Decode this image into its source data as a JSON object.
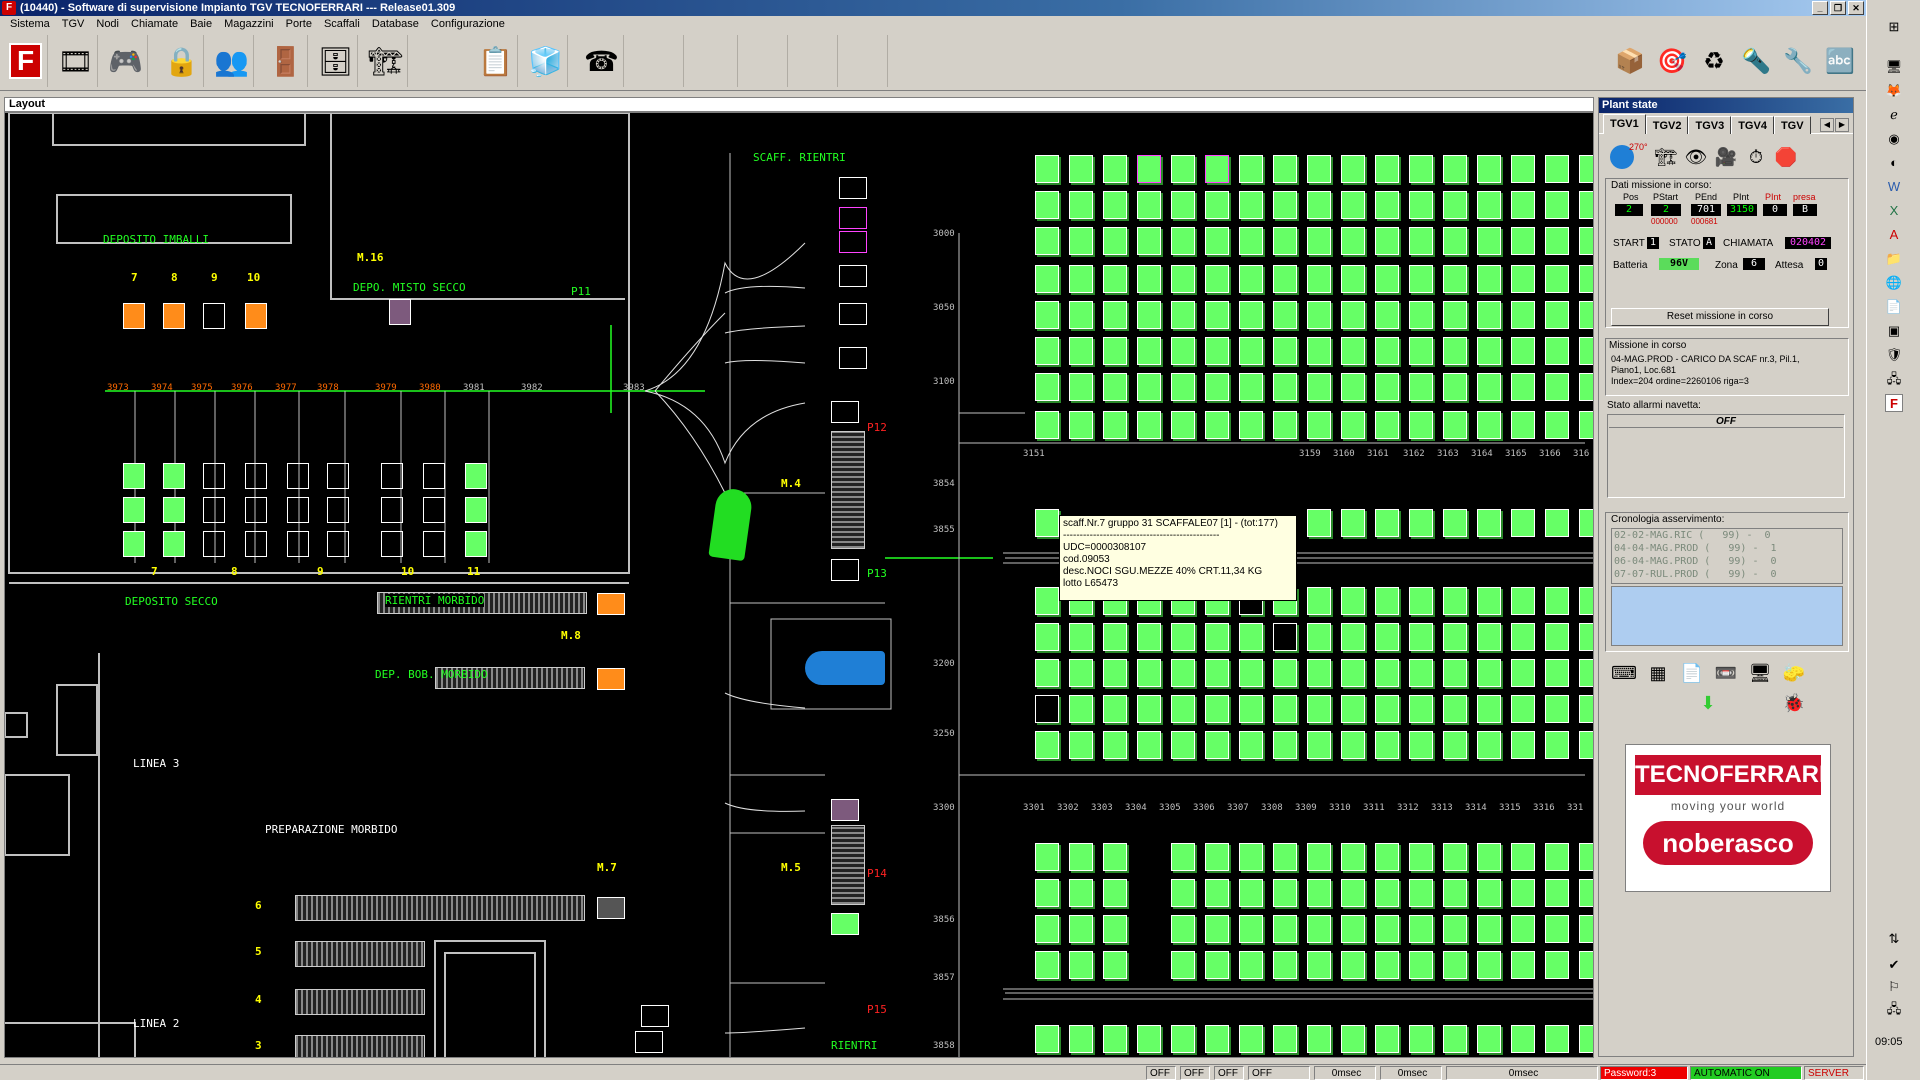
{
  "window": {
    "title": "(10440) - Software di supervisione Impianto TGV TECNOFERRARI --- Release01.309",
    "app_icon": "F"
  },
  "menu": [
    "Sistema",
    "TGV",
    "Nodi",
    "Chiamate",
    "Baie",
    "Magazzini",
    "Porte",
    "Scaffali",
    "Database",
    "Configurazione"
  ],
  "layout": {
    "header": "Layout",
    "labels": {
      "deposito_imballi": "DEPOSITO IMBALLI",
      "depo_misto_secco": "DEPO. MISTO SECCO",
      "m16": "M.16",
      "p11": "P11",
      "scaff_rientri": "SCAFF. RIENTRI",
      "deposito_secco": "DEPOSITO SECCO",
      "rientri_morbido": "RIENTRI MORBIDO",
      "dep_bob_morbido": "DEP. BOB. MORBIDO",
      "m8": "M.8",
      "m4": "M.4",
      "m5": "M.5",
      "m7": "M.7",
      "p12": "P12",
      "p13": "P13",
      "p14": "P14",
      "p15": "P15",
      "linea3": "LINEA 3",
      "linea2": "LINEA 2",
      "preparazione_morbido": "PREPARAZIONE MORBIDO",
      "rientri": "RIENTRI",
      "n7": "7",
      "n8": "8",
      "n9": "9",
      "n10": "10",
      "b7": "7",
      "b8": "8",
      "b9": "9",
      "b10": "10",
      "b11": "11",
      "l6": "6",
      "l5": "5",
      "l4": "4",
      "l3": "3"
    },
    "node_numbers": [
      "3973",
      "3974",
      "3975",
      "3976",
      "3977",
      "3978",
      "3979",
      "3980",
      "3981",
      "3982",
      "3983"
    ],
    "scaff_numbers": [
      "3000",
      "3050",
      "3100",
      "3151",
      "3854",
      "3855",
      "3200",
      "3250",
      "3300",
      "3856",
      "3857",
      "3858"
    ],
    "row_numbers_top": [
      "3159",
      "3160",
      "3161",
      "3162",
      "3163",
      "3164",
      "3165",
      "3166",
      "316"
    ],
    "row_numbers_bottom": [
      "3301",
      "3302",
      "3303",
      "3304",
      "3305",
      "3306",
      "3307",
      "3308",
      "3309",
      "3310",
      "3311",
      "3312",
      "3313",
      "3314",
      "3315",
      "3316",
      "331"
    ],
    "tooltip": {
      "line1": "scaff.Nr.7 gruppo 31 SCAFFALE07 [1] - (tot:177)",
      "sep": "-----------------------------------------------",
      "line2": "UDC=0000308107",
      "line3": "cod.09053",
      "line4": "desc.NOCI SGU.MEZZE 40% CRT.11,34 KG",
      "line5": "lotto L65473"
    }
  },
  "plant": {
    "title": "Plant state",
    "tabs": [
      "TGV1",
      "TGV2",
      "TGV3",
      "TGV4",
      "TGV"
    ],
    "angle": "270°",
    "mission_group": "Dati missione in corso:",
    "headers": {
      "pos": "Pos",
      "pstart": "PStart",
      "pend": "PEnd",
      "pint": "PInt",
      "pint2": "PInt",
      "presa": "presa"
    },
    "values": {
      "pos": "2",
      "pstart": "2",
      "pend": "701",
      "pint": "3150",
      "pint2": "0",
      "presa": "B"
    },
    "subvalues": {
      "pstart": "000000",
      "pend": "000681"
    },
    "start_label": "START",
    "start_val": "1",
    "stato_label": "STATO",
    "stato_val": "A",
    "chiamata_label": "CHIAMATA",
    "chiamata_val": "020402",
    "batteria_label": "Batteria",
    "batteria_val": "96V",
    "zona_label": "Zona",
    "zona_val": "6",
    "attesa_label": "Attesa",
    "attesa_val": "0",
    "reset_button": "Reset missione in corso",
    "missione_title": "Missione in corso",
    "missione_text1": "04-MAG.PROD - CARICO  DA SCAF nr.3, Pil.1,",
    "missione_text2": "Piano1, Loc.681",
    "missione_text3": "Index=204 ordine=2260106 riga=3",
    "allarmi_title": "Stato allarmi navetta:",
    "allarmi_val": "OFF",
    "cronologia_title": "Cronologia asservimento:",
    "cronologia": [
      "02-02-MAG.RIC (   99) -  0",
      "04-04-MAG.PROD (   99) -  1",
      "06-04-MAG.PROD (   99) -  0",
      "07-07-RUL.PROD (   99) -  0"
    ],
    "logo1": "TECNOFERRARI",
    "logo_tagline": "moving your world",
    "logo2": "noberasco"
  },
  "sidebar": {
    "clock": "09:05"
  },
  "statusbar": {
    "off1": "OFF",
    "off2": "OFF",
    "off3": "OFF",
    "off4": "OFF",
    "ms1": "0msec",
    "ms2": "0msec",
    "ms3": "0msec",
    "password": "Password:3",
    "automatic": "AUTOMATIC ON",
    "server": "SERVER"
  },
  "colors": {
    "shelf_green": "#66ff66",
    "orange": "#ff8c1a",
    "track_green": "#22ff22",
    "node_orange": "#ff6a00",
    "tgv_blue": "#1f7fd6"
  }
}
